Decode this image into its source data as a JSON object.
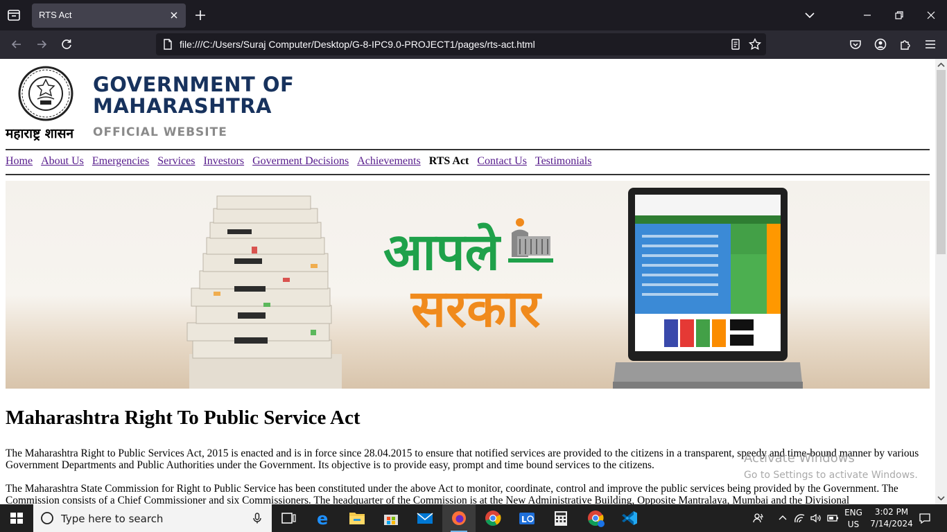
{
  "browser": {
    "tab_title": "RTS Act",
    "url": "file:///C:/Users/Suraj Computer/Desktop/G-8-IPC9.0-PROJECT1/pages/rts-act.html"
  },
  "page": {
    "emblem_caption": "महाराष्ट्र शासन",
    "gov_title_line1": "GOVERNMENT OF",
    "gov_title_line2": "MAHARASHTRA",
    "gov_subtitle": "OFFICIAL WEBSITE",
    "menu": [
      {
        "label": "Home"
      },
      {
        "label": "About Us"
      },
      {
        "label": "Emergencies"
      },
      {
        "label": "Services"
      },
      {
        "label": "Investors"
      },
      {
        "label": "Goverment Decisions"
      },
      {
        "label": "Achievements"
      },
      {
        "label": "RTS Act"
      },
      {
        "label": "Contact Us"
      },
      {
        "label": "Testimonials"
      }
    ],
    "active_menu": "RTS Act",
    "banner": {
      "logo_line1": "आपले",
      "logo_line2": "सरकार"
    },
    "heading": "Maharashtra Right To Public Service Act",
    "paragraph1": "The Maharashtra Right to Public Services Act, 2015 is enacted and is in force since 28.04.2015 to ensure that notified services are provided to the citizens in a transparent, speedy and time-bound manner by various Government Departments and Public Authorities under the Government. Its objective is to provide easy, prompt and time bound services to the citizens.",
    "paragraph2": "The Maharashtra State Commission for Right to Public Service has been constituted under the above Act to monitor, coordinate, control and improve the public services being provided by the Government. The Commission consists of a Chief Commissioner and six Commissioners. The headquarter of the Commission is at the New Administrative Building, Opposite Mantralaya, Mumbai and the Divisional"
  },
  "watermark": {
    "title": "Activate Windows",
    "subtitle": "Go to Settings to activate Windows."
  },
  "taskbar": {
    "search_placeholder": "Type here to search",
    "lang_line1": "ENG",
    "lang_line2": "US",
    "time": "3:02 PM",
    "date": "7/14/2024"
  },
  "colors": {
    "title_navy": "#17325d",
    "link_purple": "#551a8b",
    "chrome_dark": "#1c1b22",
    "toolbar": "#2b2a33",
    "taskbar": "#202020"
  }
}
